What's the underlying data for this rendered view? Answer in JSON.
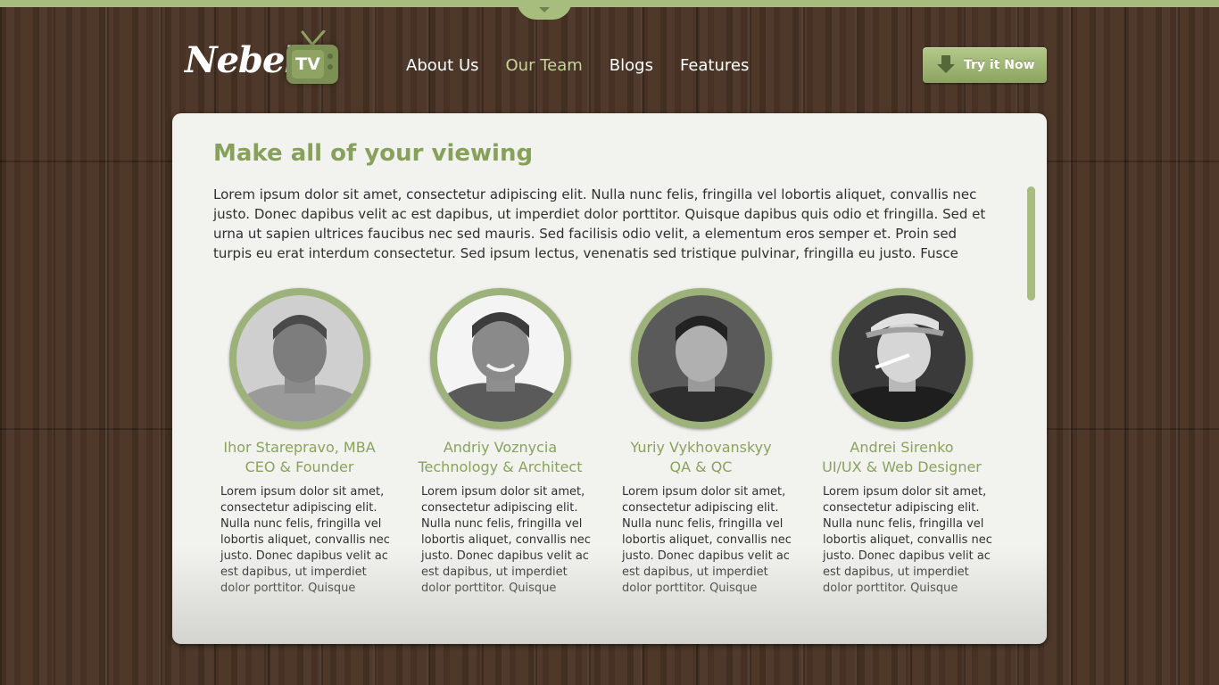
{
  "brand": {
    "logo_text": "Nebel.",
    "tv_badge": "TV"
  },
  "nav": {
    "items": [
      {
        "label": "About Us",
        "active": false
      },
      {
        "label": "Our Team",
        "active": true
      },
      {
        "label": "Blogs",
        "active": false
      },
      {
        "label": "Features",
        "active": false
      }
    ]
  },
  "cta": {
    "label": "Try it Now",
    "icon": "download-arrow-icon"
  },
  "content": {
    "title": "Make all of your viewing",
    "intro": "Lorem ipsum dolor sit amet, consectetur adipiscing elit. Nulla nunc felis, fringilla vel lobortis aliquet, convallis nec justo. Donec dapibus velit ac est dapibus, ut imperdiet dolor porttitor. Quisque dapibus quis odio et fringilla. Sed et urna ut sapien ultrices faucibus nec sed mauris. Sed facilisis odio velit, a elementum eros semper et. Proin sed turpis eu erat interdum consectetur. Sed ipsum lectus, venenatis sed tristique pulvinar, fringilla eu justo. Fusce"
  },
  "team": [
    {
      "name": "Ihor Starepravo, MBA",
      "role": "CEO & Founder",
      "bio": "Lorem ipsum dolor sit amet, consectetur adipiscing elit. Nulla nunc felis, fringilla vel lobortis aliquet, convallis nec justo. Donec dapibus velit ac est dapibus, ut imperdiet dolor porttitor. Quisque"
    },
    {
      "name": "Andriy Voznycia",
      "role": "Technology & Architect",
      "bio": "Lorem ipsum dolor sit amet, consectetur adipiscing elit. Nulla nunc felis, fringilla vel lobortis aliquet, convallis nec justo. Donec dapibus velit ac est dapibus, ut imperdiet dolor porttitor. Quisque"
    },
    {
      "name": "Yuriy Vykhovanskyy",
      "role": "QA & QC",
      "bio": "Lorem ipsum dolor sit amet, consectetur adipiscing elit. Nulla nunc felis, fringilla vel lobortis aliquet, convallis nec justo. Donec dapibus velit ac est dapibus, ut imperdiet dolor porttitor. Quisque"
    },
    {
      "name": "Andrei Sirenko",
      "role": "UI/UX & Web Designer",
      "bio": "Lorem ipsum dolor sit amet, consectetur adipiscing elit. Nulla nunc felis, fringilla vel lobortis aliquet, convallis nec justo. Donec dapibus velit ac est dapibus, ut imperdiet dolor porttitor. Quisque"
    }
  ],
  "colors": {
    "accent": "#a7bd7e",
    "heading": "#87a05a",
    "wood": "#4a3426",
    "panel": "#f2f2ef"
  }
}
